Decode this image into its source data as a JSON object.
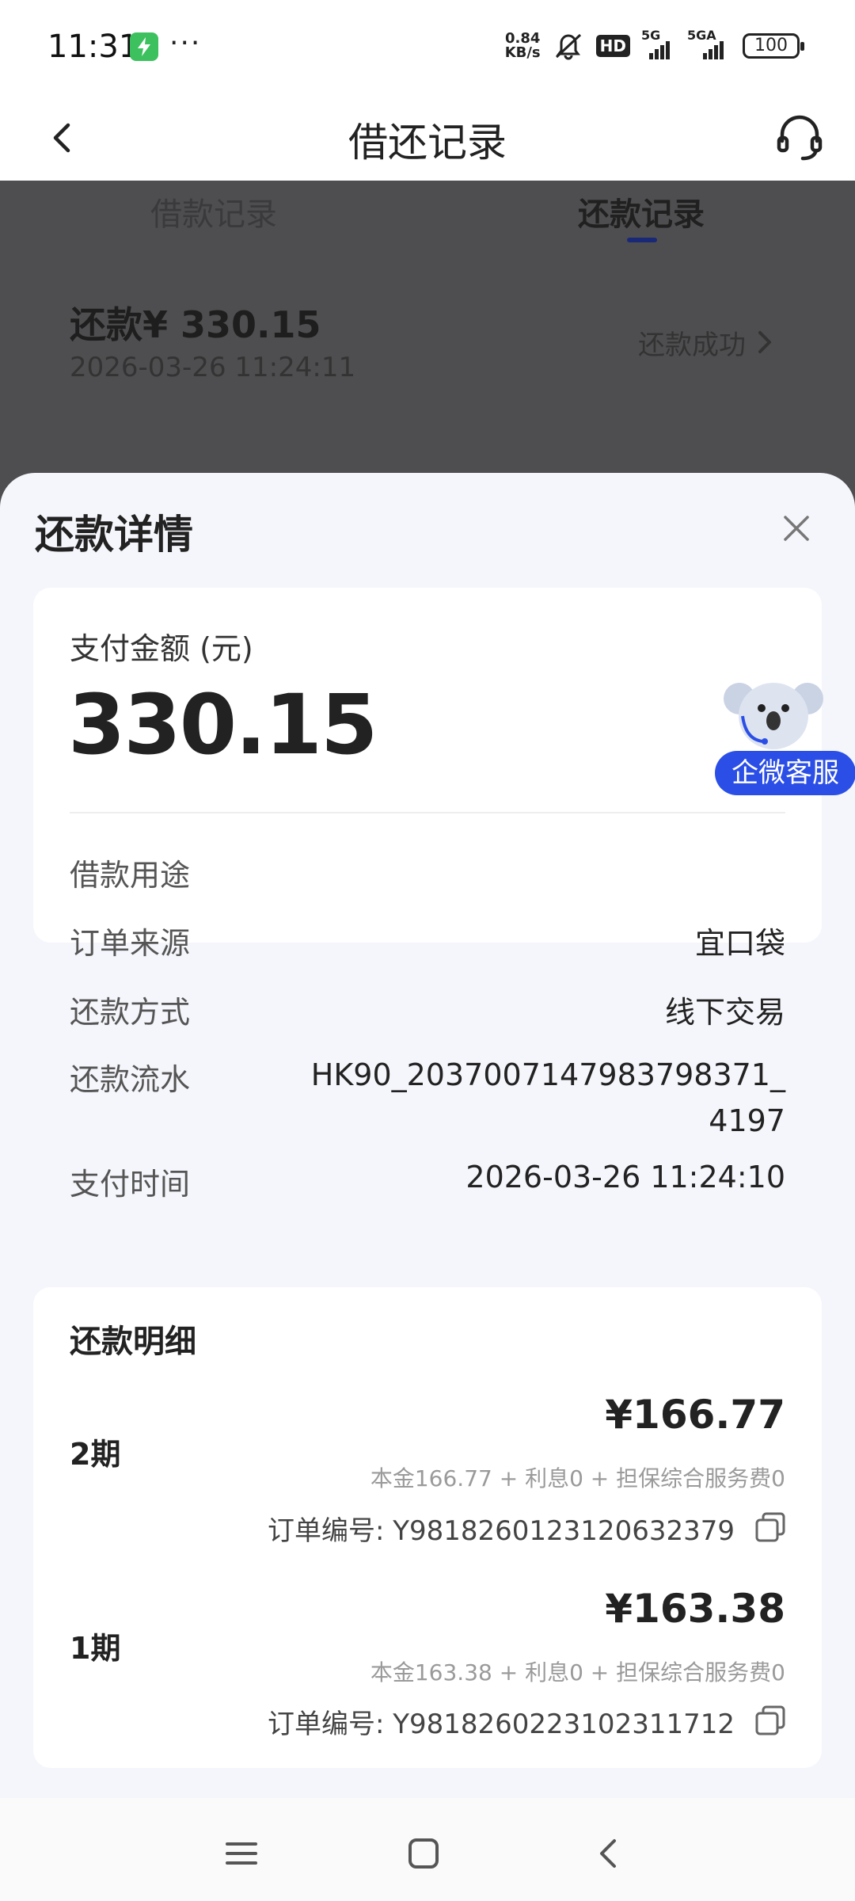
{
  "status_bar": {
    "time": "11:31",
    "app_icon": "power-app-icon",
    "overflow": "···",
    "net_speed_value": "0.84",
    "net_speed_unit": "KB/s",
    "hd_badge": "HD",
    "sim1_label": "5G",
    "sim2_label": "5GA",
    "battery": "100"
  },
  "nav": {
    "title": "借还记录",
    "back_icon": "back-arrow-icon",
    "service_icon": "headset-icon"
  },
  "tabs": [
    {
      "label": "借款记录",
      "active": false
    },
    {
      "label": "还款记录",
      "active": true
    }
  ],
  "record": {
    "amount": "还款¥ 330.15",
    "datetime": "2026-03-26 11:24:11",
    "status": "还款成功"
  },
  "sheet": {
    "title": "还款详情",
    "payment": {
      "label": "支付金额 (元)",
      "amount": "330.15"
    },
    "fields": {
      "purpose_label": "借款用途",
      "purpose_value": "",
      "source_label": "订单来源",
      "source_value": "宜口袋",
      "method_label": "还款方式",
      "method_value": "线下交易",
      "serial_label": "还款流水",
      "serial_line1": "HK90_2037007147983798371_",
      "serial_line2": "4197",
      "time_label": "支付时间",
      "time_value": "2026-03-26 11:24:10"
    },
    "detail": {
      "title": "还款明细",
      "items": [
        {
          "period": "2期",
          "amount": "¥166.77",
          "breakdown": "本金166.77 + 利息0 + 担保综合服务费0",
          "order": "订单编号: Y9818260123120632379"
        },
        {
          "period": "1期",
          "amount": "¥163.38",
          "breakdown": "本金163.38 + 利息0 + 担保综合服务费0",
          "order": "订单编号: Y9818260223102311712"
        }
      ]
    }
  },
  "float_service": {
    "label": "企微客服"
  },
  "colors": {
    "accent": "#2b4fe6",
    "tab_indicator": "#1a2878",
    "overlay": "#4e4e50",
    "sheet_bg": "#f5f6fb"
  }
}
